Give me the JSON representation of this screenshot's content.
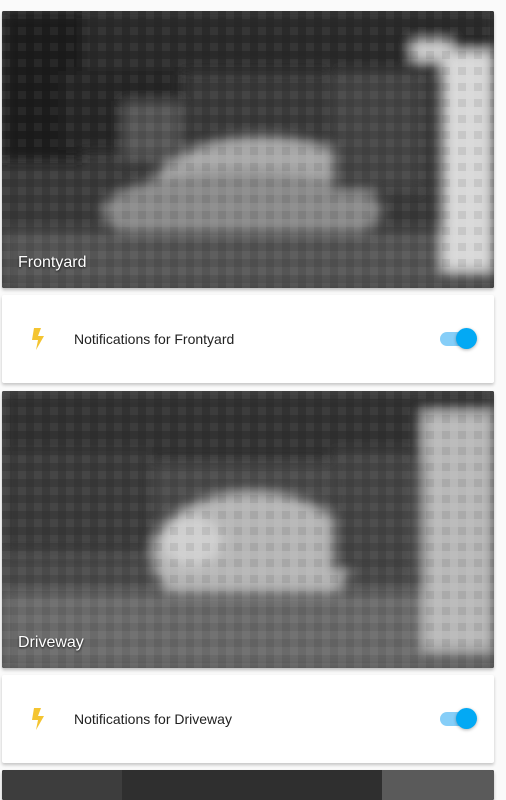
{
  "cameras": [
    {
      "title": "Frontyard",
      "notification_label": "Notifications for Frontyard",
      "notifications_enabled": true
    },
    {
      "title": "Driveway",
      "notification_label": "Notifications for Driveway",
      "notifications_enabled": true
    }
  ],
  "icons": {
    "notification": "bolt-icon"
  },
  "colors": {
    "bolt": "#f4c430",
    "toggle_thumb": "#03a9f4",
    "toggle_track": "#86cef8"
  }
}
